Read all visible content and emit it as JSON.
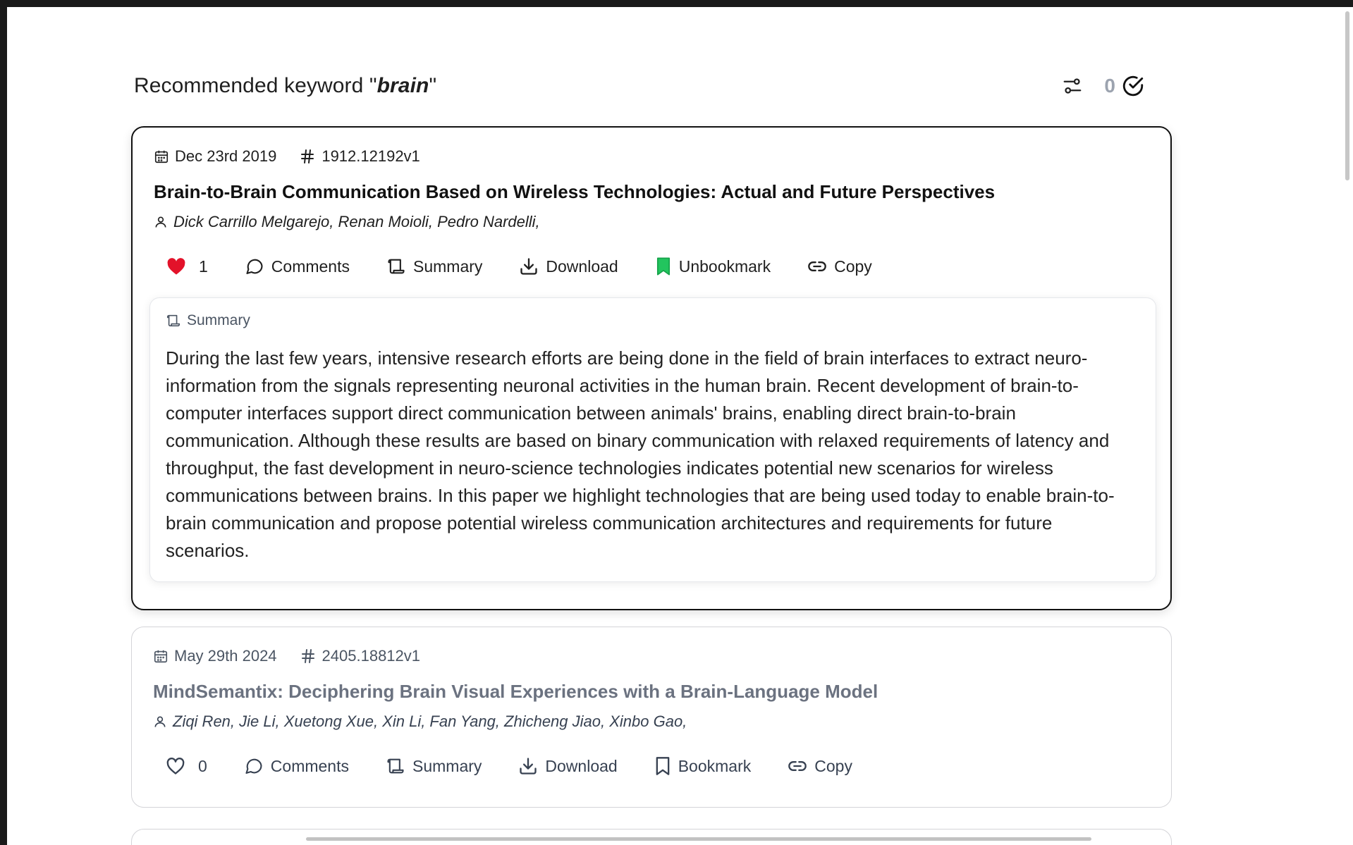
{
  "header": {
    "title_prefix": "Recommended keyword \"",
    "keyword": "brain",
    "title_suffix": "\"",
    "selected_count": "0"
  },
  "papers": [
    {
      "date": "Dec 23rd 2019",
      "id": "1912.12192v1",
      "title": "Brain-to-Brain Communication Based on Wireless Technologies: Actual and Future Perspectives",
      "authors": "Dick Carrillo Melgarejo, Renan Moioli, Pedro Nardelli,",
      "likes": "1",
      "liked": true,
      "actions": {
        "comments": "Comments",
        "summary": "Summary",
        "download": "Download",
        "bookmark": "Unbookmark",
        "copy": "Copy"
      },
      "bookmarked": true,
      "summary_label": "Summary",
      "summary": "During the last few years, intensive research efforts are being done in the field of brain interfaces to extract neuro-information from the signals representing neuronal activities in the human brain. Recent development of brain-to-computer interfaces support direct communication between animals' brains, enabling direct brain-to-brain communication. Although these results are based on binary communication with relaxed requirements of latency and throughput, the fast development in neuro-science technologies indicates potential new scenarios for wireless communications between brains. In this paper we highlight technologies that are being used today to enable brain-to-brain communication and propose potential wireless communication architectures and requirements for future scenarios."
    },
    {
      "date": "May 29th 2024",
      "id": "2405.18812v1",
      "title": "MindSemantix: Deciphering Brain Visual Experiences with a Brain-Language Model",
      "authors": "Ziqi Ren, Jie Li, Xuetong Xue, Xin Li, Fan Yang, Zhicheng Jiao, Xinbo Gao,",
      "likes": "0",
      "liked": false,
      "actions": {
        "comments": "Comments",
        "summary": "Summary",
        "download": "Download",
        "bookmark": "Bookmark",
        "copy": "Copy"
      },
      "bookmarked": false
    }
  ],
  "colors": {
    "heart": "#e3122a",
    "bookmark_active": "#22c55e",
    "muted_count": "#9ca3af"
  }
}
